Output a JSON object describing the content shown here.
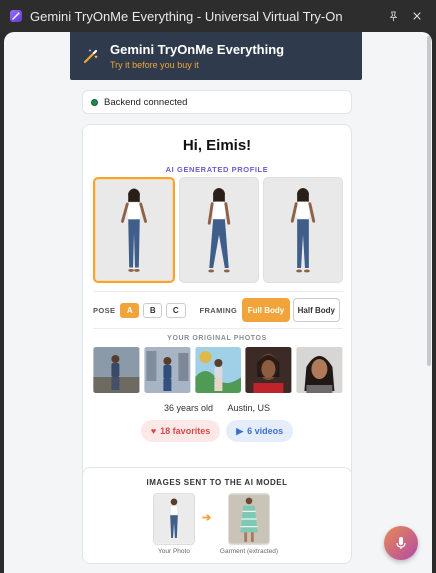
{
  "window": {
    "title": "Gemini TryOnMe Everything - Universal Virtual Try-On",
    "icons": [
      "wand-icon",
      "pin-icon",
      "close-icon"
    ]
  },
  "header": {
    "title": "Gemini TryOnMe Everything",
    "subtitle": "Try it before you buy it",
    "accent": "#f0a43a",
    "background": "#2f3b4c"
  },
  "status": {
    "text": "Backend connected",
    "color": "#1f8a4c"
  },
  "profile": {
    "greeting": "Hi, Eimis!",
    "ai_label": "AI GENERATED PROFILE",
    "selected_index": 0,
    "pose_label": "POSE",
    "poses": [
      "A",
      "B",
      "C"
    ],
    "active_pose": "A",
    "framing_label": "FRAMING",
    "framing_full": "Full Body",
    "framing_half": "Half Body",
    "active_framing": "Full Body",
    "original_label": "YOUR ORIGINAL PHOTOS",
    "age": "36 years old",
    "location": "Austin, US",
    "favorites": "18 favorites",
    "videos": "6 videos"
  },
  "model_inputs": {
    "title": "IMAGES SENT TO THE AI MODEL",
    "photo_caption": "Your Photo",
    "garment_caption": "Garment (extracted)"
  },
  "mic": {
    "icon": "microphone-icon"
  }
}
